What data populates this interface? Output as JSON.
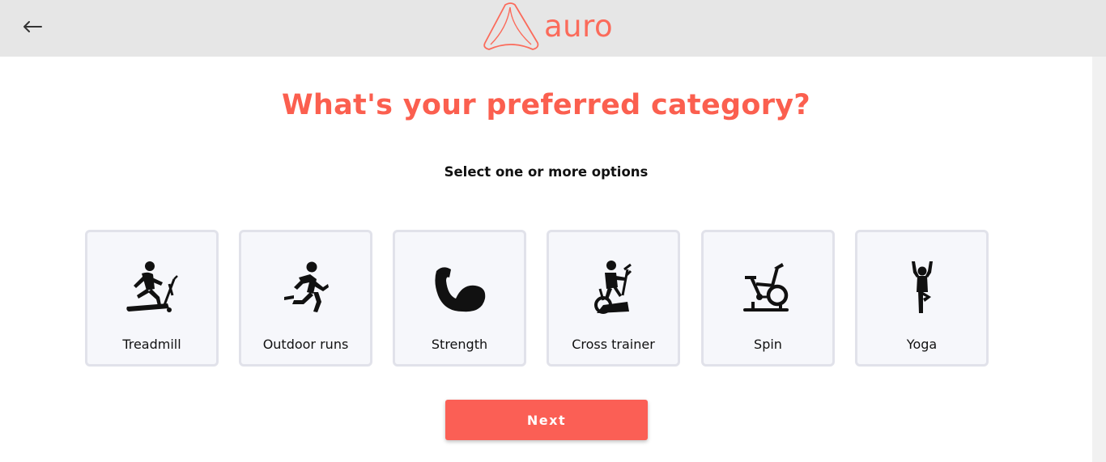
{
  "header": {
    "back_icon": "arrow-left-icon",
    "logo_text": "auro",
    "logo_icon": "auro-logo-icon"
  },
  "colors": {
    "brand": "#fb5f4f",
    "header_bg": "#e6e6e6",
    "card_bg": "#f6f7fb",
    "card_border": "#e1e2ea",
    "button_bg": "#fb5f55"
  },
  "main": {
    "title": "What's your preferred category?",
    "subtitle": "Select one or more options",
    "options": [
      {
        "label": "Treadmill",
        "icon": "treadmill-icon"
      },
      {
        "label": "Outdoor runs",
        "icon": "runner-icon"
      },
      {
        "label": "Strength",
        "icon": "flexed-bicep-icon"
      },
      {
        "label": "Cross trainer",
        "icon": "cross-trainer-icon"
      },
      {
        "label": "Spin",
        "icon": "spin-bike-icon"
      },
      {
        "label": "Yoga",
        "icon": "yoga-pose-icon"
      }
    ],
    "next_label": "Next"
  }
}
